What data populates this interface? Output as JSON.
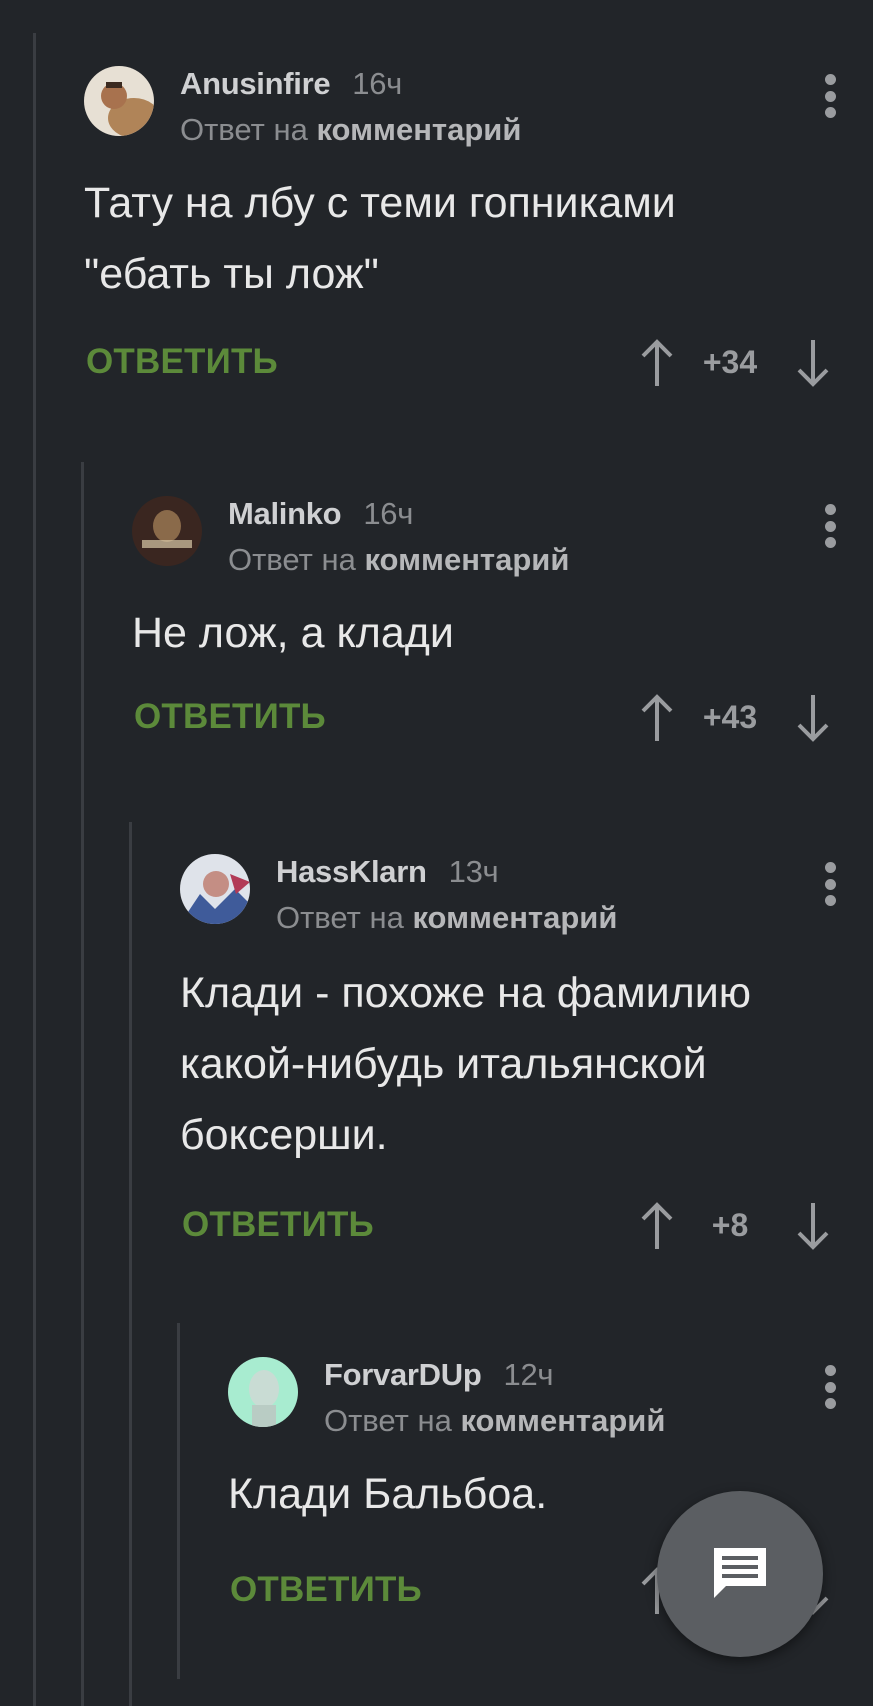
{
  "reply_prefix": "Ответ на",
  "reply_target": "комментарий",
  "comments": [
    {
      "author": "Anusinfire",
      "time": "16ч",
      "text": "Тату на лбу с теми гопниками\n\"ебать ты лож\"",
      "reply_label": "ОТВЕТИТЬ",
      "score": "+34"
    },
    {
      "author": "Malinko",
      "time": "16ч",
      "text": "Не лож, а клади",
      "reply_label": "ОТВЕТИТЬ",
      "score": "+43"
    },
    {
      "author": "HassKlarn",
      "time": "13ч",
      "text": "Клади - похоже на фамилию\nкакой-нибудь итальянской\nбоксерши.",
      "reply_label": "ОТВЕТИТЬ",
      "score": "+8"
    },
    {
      "author": "ForvarDUp",
      "time": "12ч",
      "text": "Клади Бальбоа.",
      "reply_label": "ОТВЕТИТЬ",
      "score": ""
    }
  ],
  "fab": {
    "icon": "message-icon"
  },
  "colors": {
    "background": "#222529",
    "reply_accent": "#5c8a3a",
    "thread_line": "#3a3d42",
    "fab": "#5b5e62"
  }
}
